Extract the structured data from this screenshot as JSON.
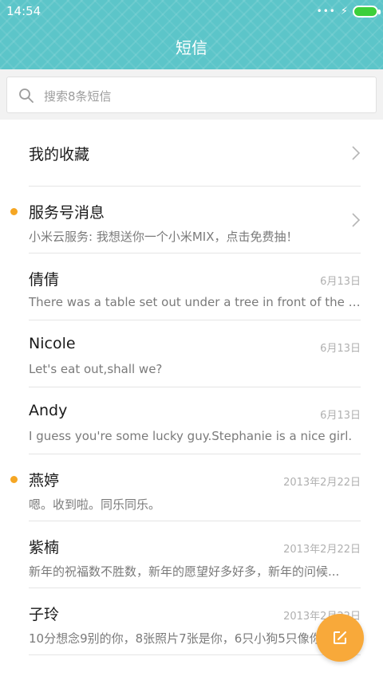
{
  "status_bar": {
    "time": "14:54"
  },
  "header": {
    "title": "短信"
  },
  "search": {
    "placeholder": "搜索8条短信"
  },
  "favorites": {
    "label": "我的收藏"
  },
  "conversations": [
    {
      "name": "服务号消息",
      "preview": "小米云服务: 我想送你一个小米MIX，点击免费抽！",
      "date": "",
      "unread": true,
      "chevron": true
    },
    {
      "name": "倩倩",
      "preview": "There was a table set out under a tree in front of the ho...",
      "date": "6月13日",
      "unread": false
    },
    {
      "name": "Nicole",
      "preview": "Let's eat out,shall we?",
      "date": "6月13日",
      "unread": false
    },
    {
      "name": "Andy",
      "preview": "I guess you're some lucky guy.Stephanie is a nice girl.",
      "date": "6月13日",
      "unread": false
    },
    {
      "name": "燕婷",
      "preview": "嗯。收到啦。同乐同乐。",
      "date": "2013年2月22日",
      "unread": true
    },
    {
      "name": "紫楠",
      "preview": "新年的祝福数不胜数，新年的愿望好多好多，新年的问候...",
      "date": "2013年2月22日",
      "unread": false
    },
    {
      "name": "子玲",
      "preview": "10分想念9别的你，8张照片7张是你，6只小狗5只像你...",
      "date": "2013年2月22日",
      "unread": false
    }
  ],
  "colors": {
    "header": "#5cc5c9",
    "unread_dot": "#f5a623",
    "fab": "#f8a93a",
    "battery": "#3ccf3a"
  },
  "icons": {
    "search": "search-icon",
    "chevron": "chevron-right-icon",
    "compose": "compose-icon"
  }
}
